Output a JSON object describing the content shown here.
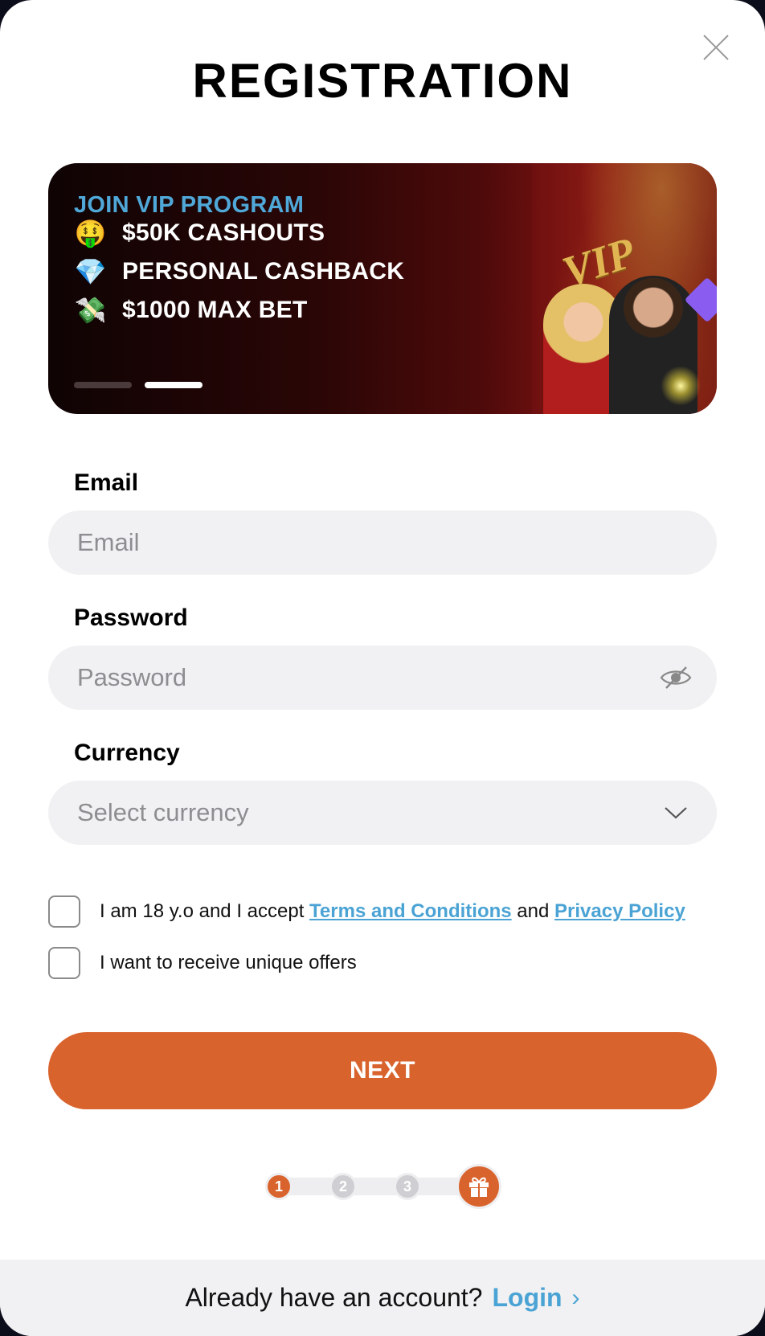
{
  "modal": {
    "title": "REGISTRATION",
    "close_icon": "close-icon"
  },
  "banner": {
    "heading": "JOIN VIP PROGRAM",
    "perks": [
      {
        "emoji": "🤑",
        "icon": "money-mouth-face-icon",
        "text": "$50K CASHOUTS"
      },
      {
        "emoji": "💎",
        "icon": "gem-icon",
        "text": "PERSONAL CASHBACK"
      },
      {
        "emoji": "💸",
        "icon": "money-with-wings-icon",
        "text": "$1000 MAX BET"
      }
    ],
    "art_text": "VIP",
    "slides": {
      "count": 2,
      "active_index": 1
    }
  },
  "form": {
    "email": {
      "label": "Email",
      "placeholder": "Email",
      "value": ""
    },
    "password": {
      "label": "Password",
      "placeholder": "Password",
      "value": "",
      "toggle_icon": "eye-slash-icon"
    },
    "currency": {
      "label": "Currency",
      "placeholder": "Select currency",
      "icon": "chevron-down-icon"
    }
  },
  "consents": {
    "terms": {
      "checked": false,
      "prefix": "I am 18 y.o and I accept ",
      "terms_link": "Terms and Conditions",
      "middle": " and ",
      "privacy_link": "Privacy Policy"
    },
    "offers": {
      "checked": false,
      "text": "I want to receive unique offers"
    }
  },
  "next_button": {
    "label": "NEXT"
  },
  "stepper": {
    "steps": [
      "1",
      "2",
      "3"
    ],
    "current_step": 1,
    "final_icon": "gift-icon"
  },
  "footer": {
    "prompt": "Already have an account?",
    "login_label": "Login",
    "chevron": "›"
  },
  "colors": {
    "accent_orange": "#d9632d",
    "link_blue": "#4aa3d4",
    "field_bg": "#f1f1f3",
    "placeholder": "#8e8e92"
  }
}
